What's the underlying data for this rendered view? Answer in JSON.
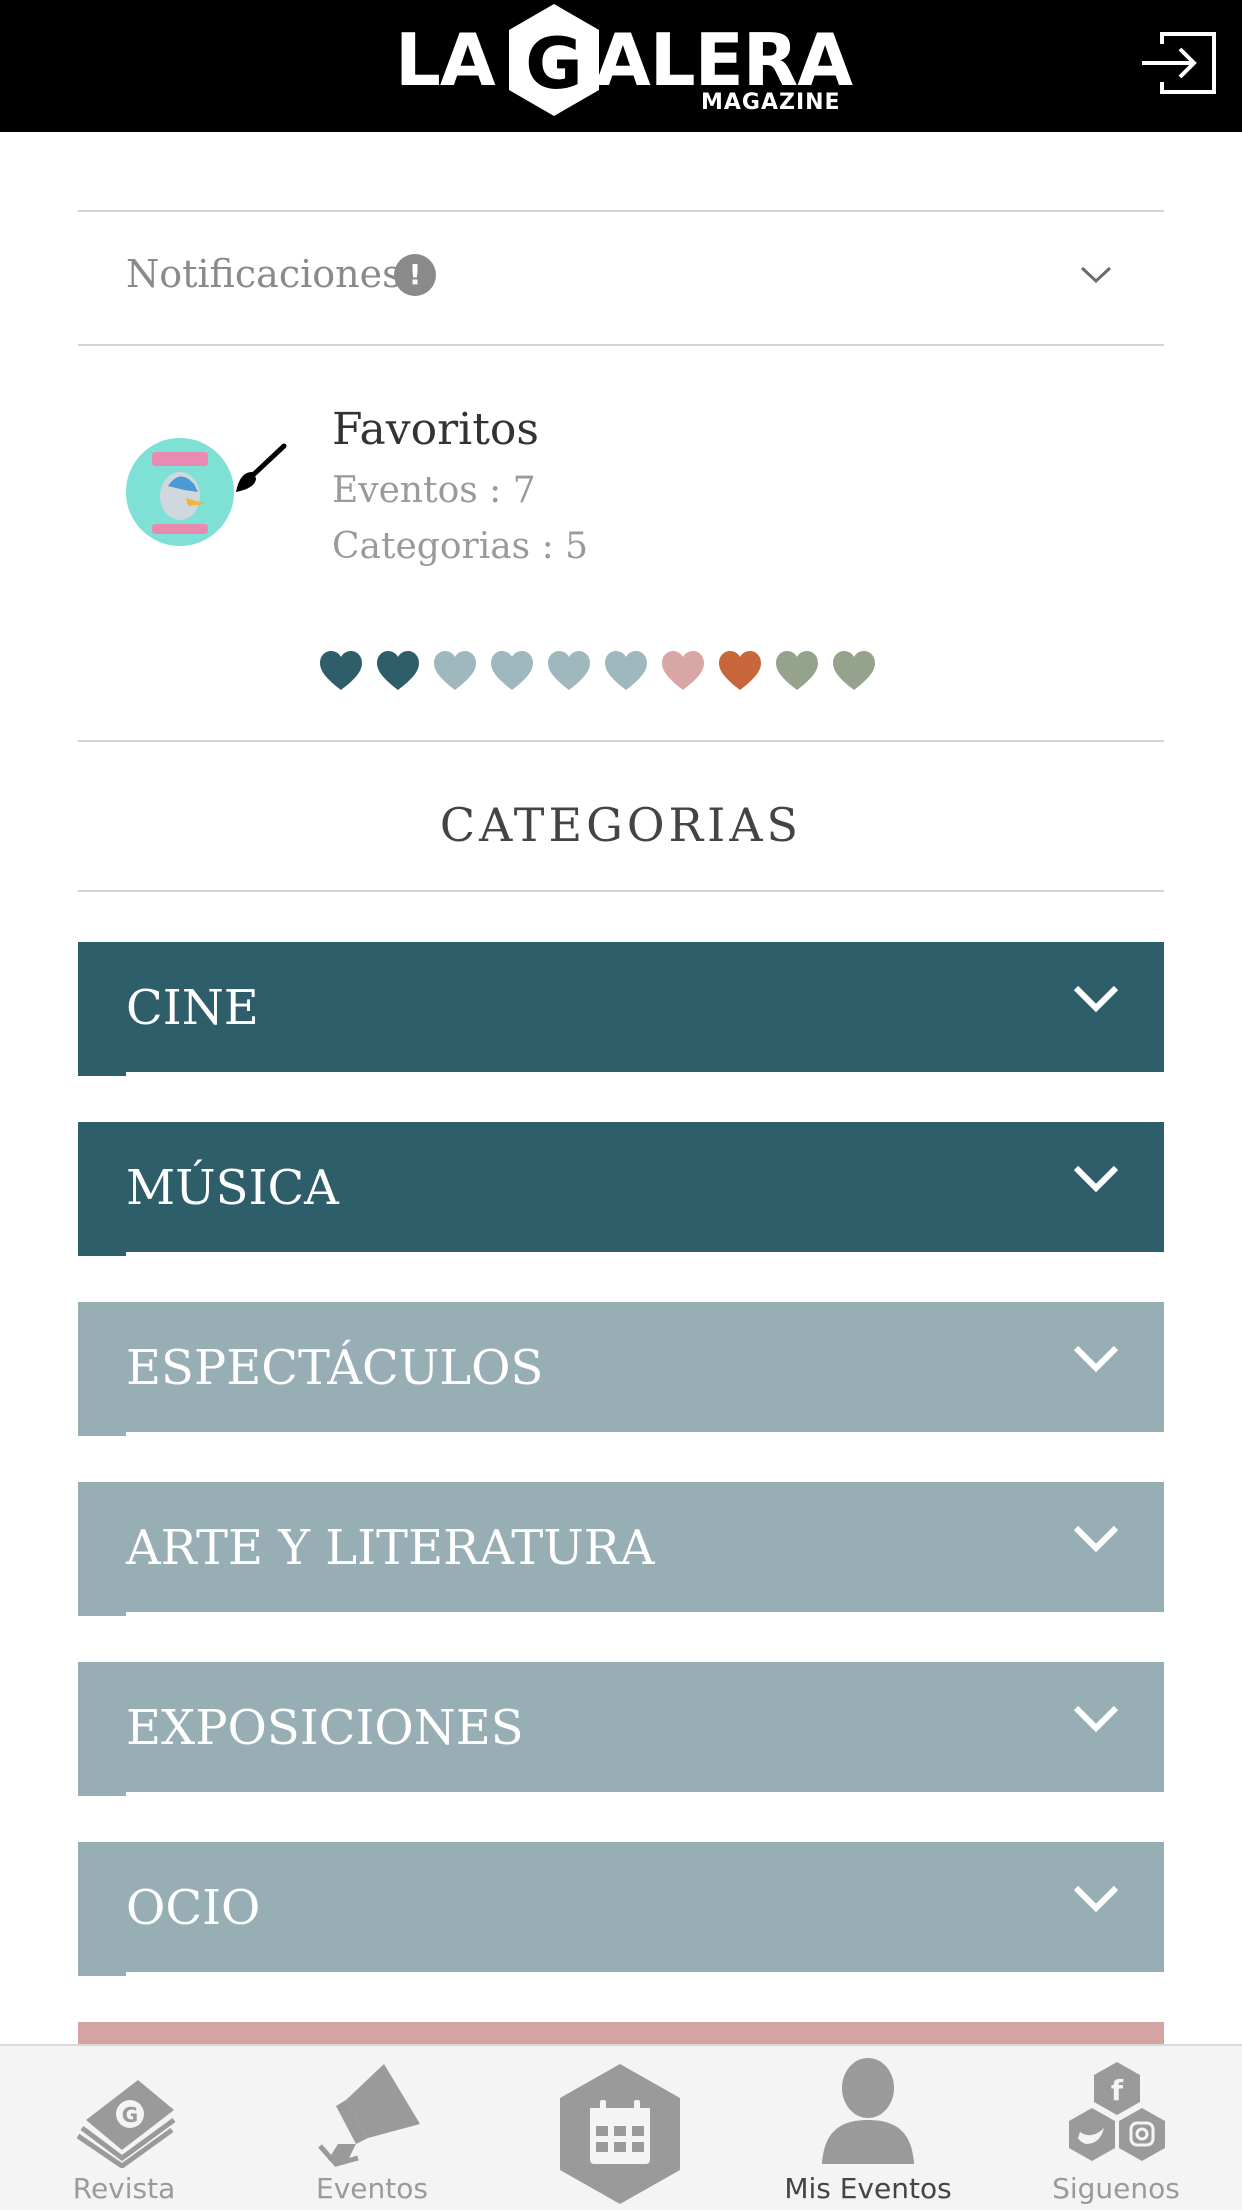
{
  "header": {
    "logo_la": "LA",
    "logo_galera": "ALERA",
    "logo_g": "G",
    "logo_sub": "MAGAZINE",
    "logout_icon": "logout-icon"
  },
  "notifications": {
    "label": "Notificaciones",
    "badge": "!",
    "expanded": false
  },
  "favorites": {
    "title": "Favoritos",
    "events_line": "Eventos : 7",
    "categories_line": "Categorias : 5",
    "hearts": [
      {
        "color": "#2f5e6b"
      },
      {
        "color": "#2f5e6b"
      },
      {
        "color": "#9fb8bd"
      },
      {
        "color": "#9fb8bd"
      },
      {
        "color": "#9fb8bd"
      },
      {
        "color": "#9fb8bd"
      },
      {
        "color": "#d9a6a6"
      },
      {
        "color": "#c8663c"
      },
      {
        "color": "#96a38c"
      },
      {
        "color": "#96a38c"
      }
    ]
  },
  "categories": {
    "heading": "CATEGORIAS",
    "items": [
      {
        "label": "CINE",
        "color": "#2f5e6b"
      },
      {
        "label": "MÚSICA",
        "color": "#2f5e6b"
      },
      {
        "label": "ESPECTÁCULOS",
        "color": "#97afb4"
      },
      {
        "label": "ARTE Y LITERATURA",
        "color": "#97afb4"
      },
      {
        "label": "EXPOSICIONES",
        "color": "#97afb4"
      },
      {
        "label": "OCIO",
        "color": "#97afb4"
      }
    ],
    "partial_next_color": "#d4a4a2"
  },
  "nav": {
    "items": [
      {
        "label": "Revista",
        "icon": "magazine-icon",
        "active": false
      },
      {
        "label": "Eventos",
        "icon": "megaphone-icon",
        "active": false
      },
      {
        "label": "",
        "icon": "calendar-icon",
        "active": false
      },
      {
        "label": "Mis Eventos",
        "icon": "user-icon",
        "active": true
      },
      {
        "label": "Siguenos",
        "icon": "social-icon",
        "active": false
      }
    ]
  }
}
